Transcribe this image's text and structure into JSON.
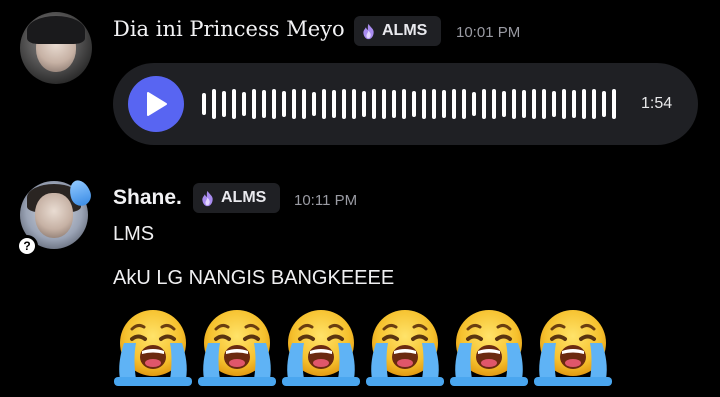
{
  "messages": [
    {
      "author": "Dia ini Princess Meyo",
      "tag": "ALMS",
      "time": "10:01 PM",
      "voice": {
        "duration": "1:54"
      }
    },
    {
      "author": "Shane.",
      "tag": "ALMS",
      "time": "10:11 PM",
      "lines": [
        "LMS",
        "AkU LG NANGIS BANGKEEEE"
      ],
      "emoji": {
        "name": "loudly-crying-face-icon",
        "count": 6
      }
    }
  ],
  "colors": {
    "play_button": "#5865f2",
    "bubble_bg": "#1f2024",
    "timestamp": "#9a9ba3",
    "tag_icon": "#a98cf0"
  }
}
